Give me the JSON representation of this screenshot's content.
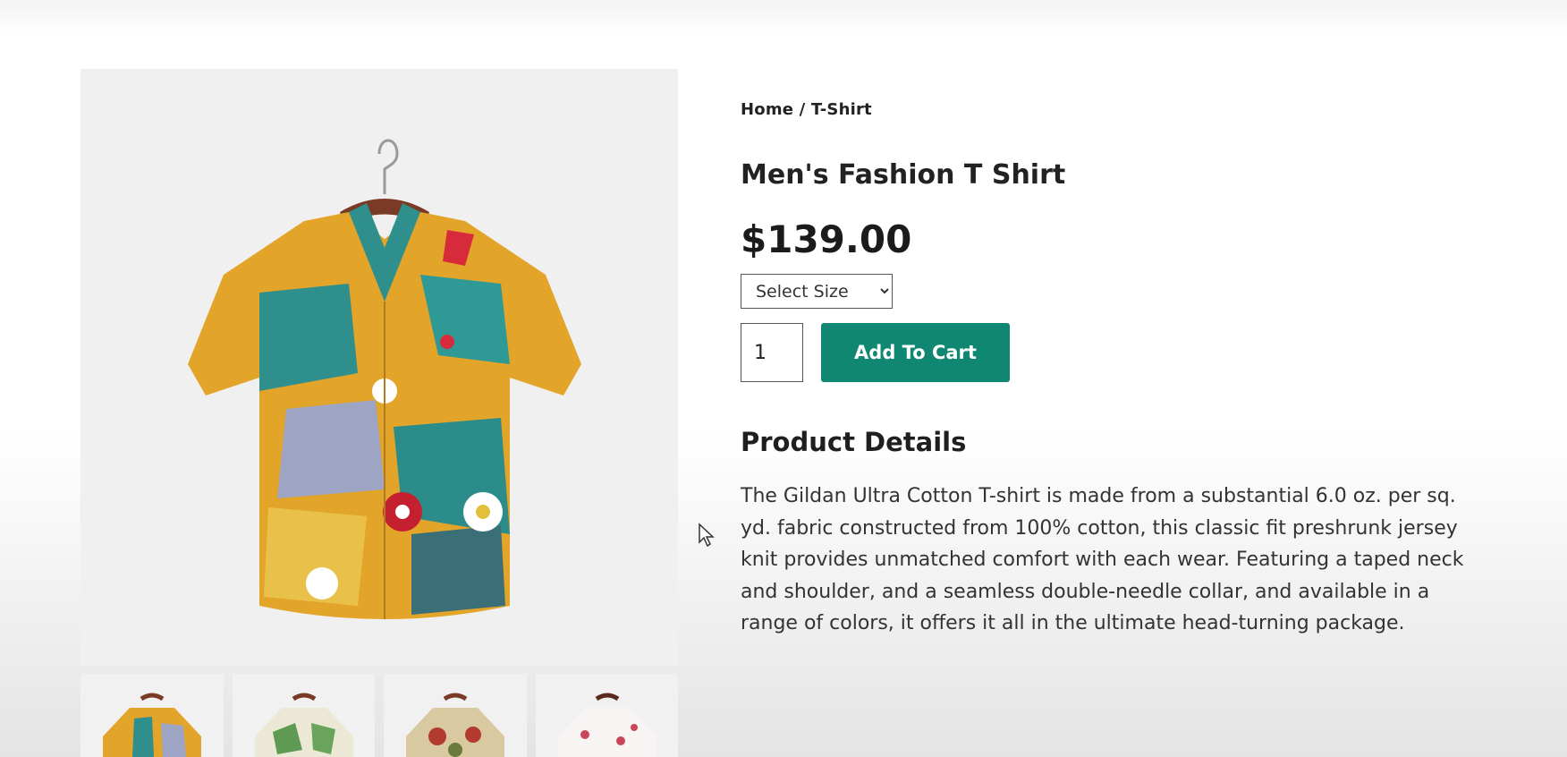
{
  "breadcrumb": {
    "home": "Home",
    "separator": "/",
    "current": "T-Shirt"
  },
  "product": {
    "title": "Men's Fashion T Shirt",
    "price": "$139.00",
    "size_select": {
      "selected": "Select Size",
      "options": [
        "Select Size"
      ]
    },
    "quantity": "1",
    "add_to_cart_label": "Add To Cart",
    "details_heading": "Product Details",
    "description": "The Gildan Ultra Cotton T-shirt is made from a substantial 6.0 oz. per sq. yd. fabric constructed from 100% cotton, this classic fit preshrunk jersey knit provides unmatched comfort with each wear. Featuring a taped neck and shoulder, and a seamless double-needle collar, and available in a range of colors, it offers it all in the ultimate head-turning package."
  },
  "gallery": {
    "main_image": "shirt-multicolor-floral",
    "thumbnails": [
      "shirt-multicolor-floral",
      "shirt-green-leaf",
      "shirt-red-floral",
      "shirt-white-floral"
    ]
  },
  "colors": {
    "accent": "#108773",
    "text": "#222222"
  }
}
